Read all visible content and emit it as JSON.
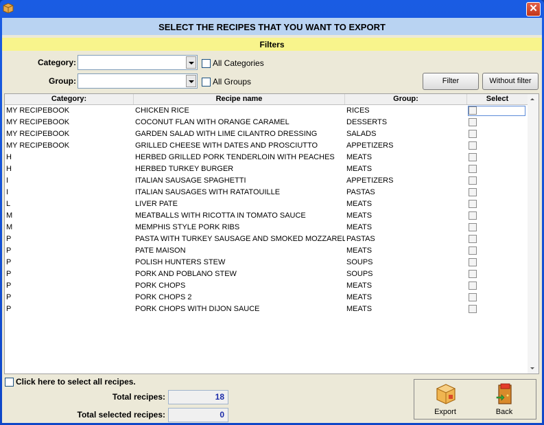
{
  "header": {
    "title": "SELECT THE RECIPES THAT YOU WANT TO EXPORT"
  },
  "filters": {
    "title": "Filters",
    "category_label": "Category:",
    "group_label": "Group:",
    "category_value": "",
    "group_value": "",
    "all_categories_label": "All Categories",
    "all_groups_label": "All Groups",
    "filter_button": "Filter",
    "without_filter_button": "Without filter"
  },
  "grid": {
    "columns": [
      "Category:",
      "Recipe name",
      "Group:",
      "Select"
    ],
    "rows": [
      {
        "category": "MY RECIPEBOOK",
        "name": "CHICKEN RICE",
        "group": "RICES"
      },
      {
        "category": "MY RECIPEBOOK",
        "name": "COCONUT FLAN WITH ORANGE CARAMEL",
        "group": "DESSERTS"
      },
      {
        "category": "MY RECIPEBOOK",
        "name": "GARDEN SALAD WITH LIME CILANTRO DRESSING",
        "group": "SALADS"
      },
      {
        "category": "MY RECIPEBOOK",
        "name": "GRILLED CHEESE WITH DATES AND PROSCIUTTO",
        "group": "APPETIZERS"
      },
      {
        "category": "H",
        "name": "HERBED GRILLED PORK TENDERLOIN WITH PEACHES",
        "group": "MEATS"
      },
      {
        "category": "H",
        "name": "HERBED TURKEY BURGER",
        "group": "MEATS"
      },
      {
        "category": "I",
        "name": "ITALIAN SAUSAGE SPAGHETTI",
        "group": "APPETIZERS"
      },
      {
        "category": "I",
        "name": "ITALIAN SAUSAGES WITH RATATOUILLE",
        "group": "PASTAS"
      },
      {
        "category": "L",
        "name": "LIVER PATE",
        "group": "MEATS"
      },
      {
        "category": "M",
        "name": "MEATBALLS WITH RICOTTA IN TOMATO SAUCE",
        "group": "MEATS"
      },
      {
        "category": "M",
        "name": "MEMPHIS STYLE PORK RIBS",
        "group": "MEATS"
      },
      {
        "category": "P",
        "name": "PASTA WITH TURKEY SAUSAGE AND SMOKED MOZZARELLA",
        "group": "PASTAS"
      },
      {
        "category": "P",
        "name": "PATE MAISON",
        "group": "MEATS"
      },
      {
        "category": "P",
        "name": "POLISH HUNTERS STEW",
        "group": "SOUPS"
      },
      {
        "category": "P",
        "name": "PORK AND POBLANO STEW",
        "group": "SOUPS"
      },
      {
        "category": "P",
        "name": "PORK CHOPS",
        "group": "MEATS"
      },
      {
        "category": "P",
        "name": "PORK CHOPS 2",
        "group": "MEATS"
      },
      {
        "category": "P",
        "name": "PORK CHOPS WITH DIJON SAUCE",
        "group": "MEATS"
      }
    ]
  },
  "footer": {
    "select_all_label": "Click here to select all recipes.",
    "total_recipes_label": "Total recipes:",
    "total_recipes_value": "18",
    "total_selected_label": "Total selected recipes:",
    "total_selected_value": "0",
    "export_label": "Export",
    "back_label": "Back"
  },
  "colors": {
    "header_bg": "#b9d3f2",
    "filters_bg": "#f8f48c",
    "window_frame": "#1a5ce3",
    "totals_text": "#1a2aa8"
  },
  "icons": {
    "app": "box-icon",
    "close": "close-icon",
    "export": "box-export-icon",
    "back": "exit-door-icon"
  }
}
